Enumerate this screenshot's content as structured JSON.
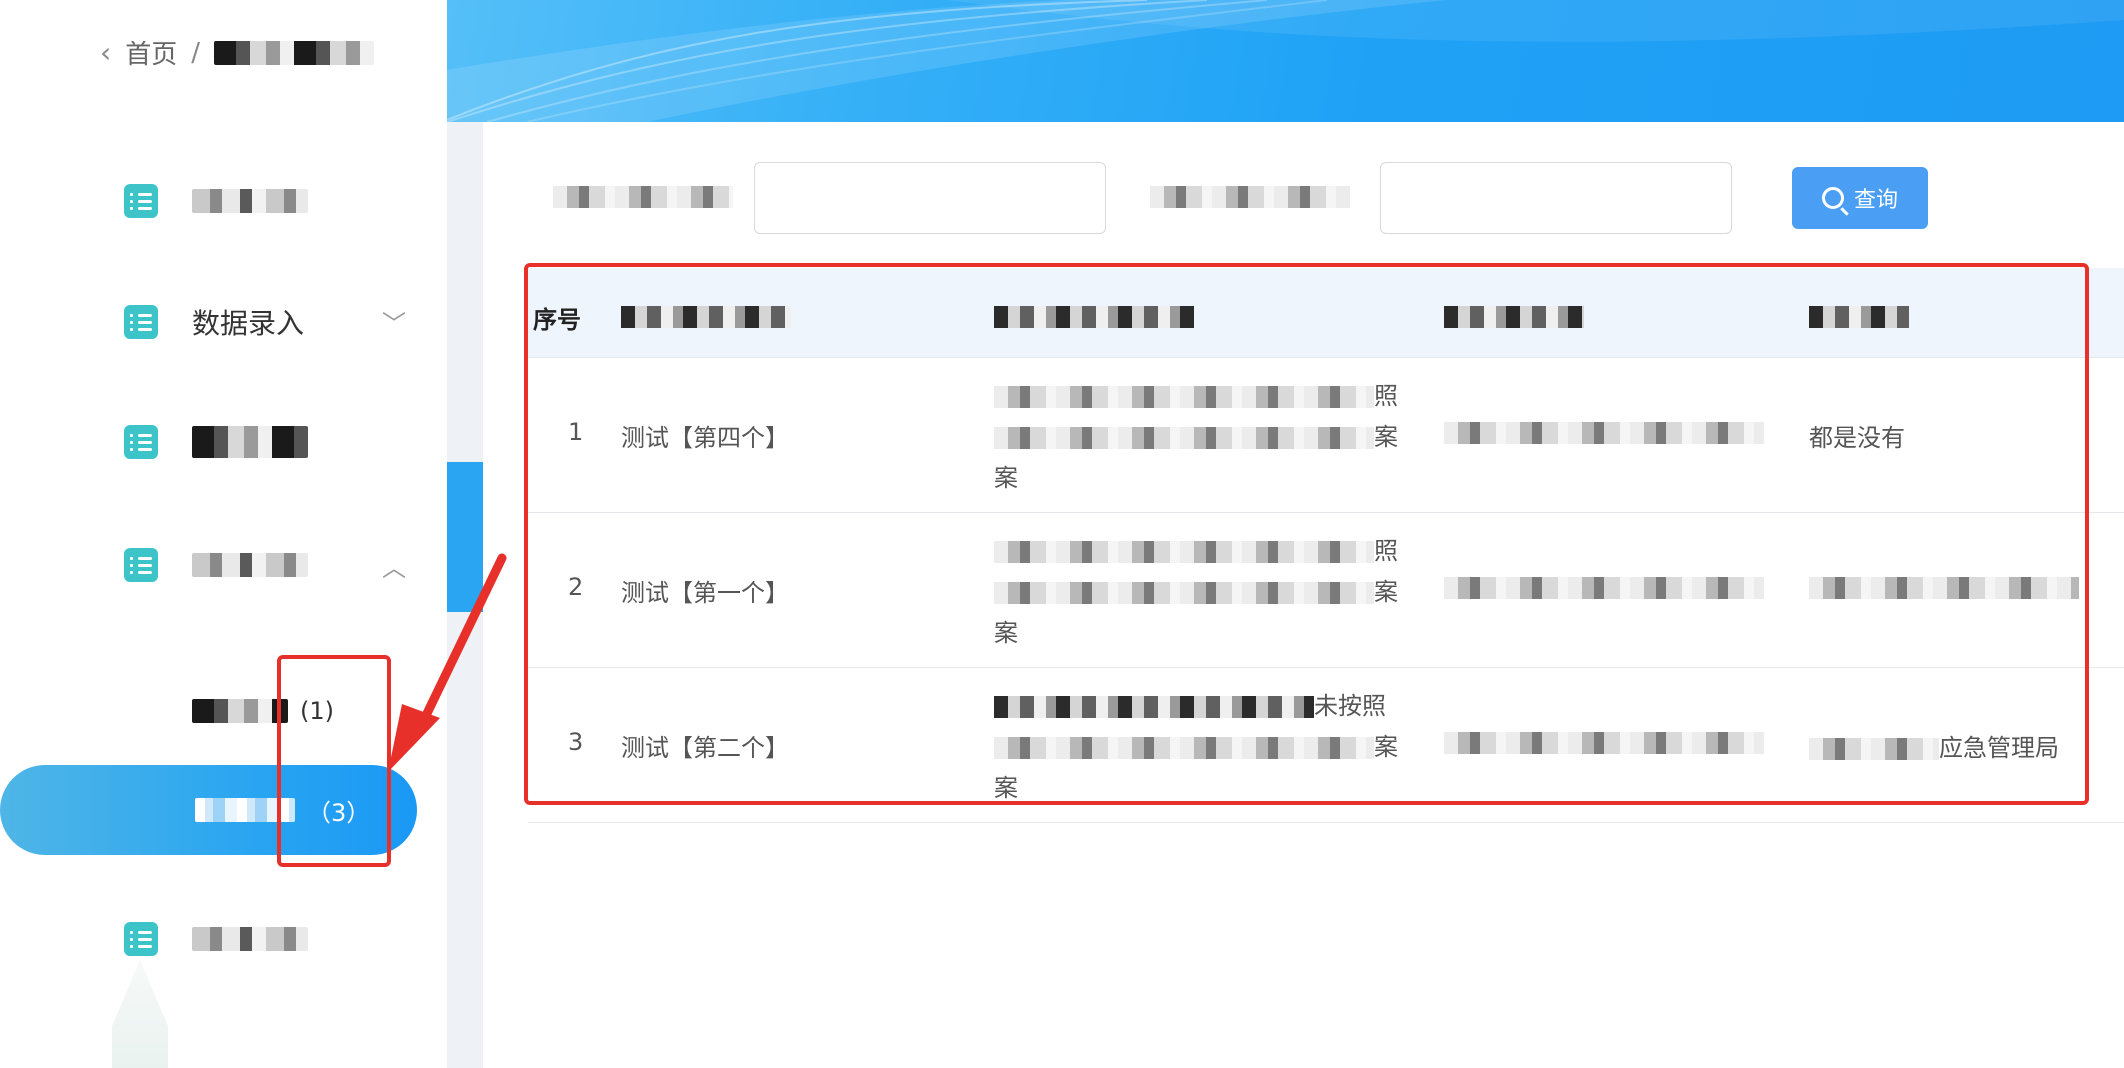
{
  "breadcrumb": {
    "back_icon": "chevron-left-icon",
    "home": "首页",
    "separator": "/"
  },
  "sidebar": {
    "items": [
      {
        "label": "",
        "icon": "list-icon"
      },
      {
        "label": "数据录入",
        "icon": "list-icon",
        "chevron": "﹀"
      },
      {
        "label": "",
        "icon": "list-icon"
      },
      {
        "label": "",
        "icon": "list-icon",
        "chevron": "︿"
      },
      {
        "label": "",
        "icon": "list-icon"
      }
    ],
    "sub_items": [
      {
        "count": "(1)"
      },
      {
        "count": "（3）",
        "active": true
      }
    ]
  },
  "search": {
    "field1_placeholder": "",
    "field2_placeholder": "",
    "query_button": "查询"
  },
  "table": {
    "headers": {
      "index": "序号"
    },
    "rows": [
      {
        "index": "1",
        "name": "测试【第四个】",
        "desc_line1_tail": "照",
        "desc_line2_tail": "案",
        "desc_line3": "案",
        "col5": "都是没有"
      },
      {
        "index": "2",
        "name": "测试【第一个】",
        "desc_line1_tail": "照",
        "desc_line2_tail": "案",
        "desc_line3": "案",
        "col5": ""
      },
      {
        "index": "3",
        "name": "测试【第二个】",
        "desc_line1_tail": "未按照",
        "desc_line2_tail": "案",
        "desc_line3": "案",
        "col5": "应急管理局"
      }
    ]
  },
  "colors": {
    "accent": "#2aa5f1",
    "annotation": "#e8302b",
    "icon_teal": "#3cc4c9",
    "table_header_bg": "#eef5fc"
  }
}
